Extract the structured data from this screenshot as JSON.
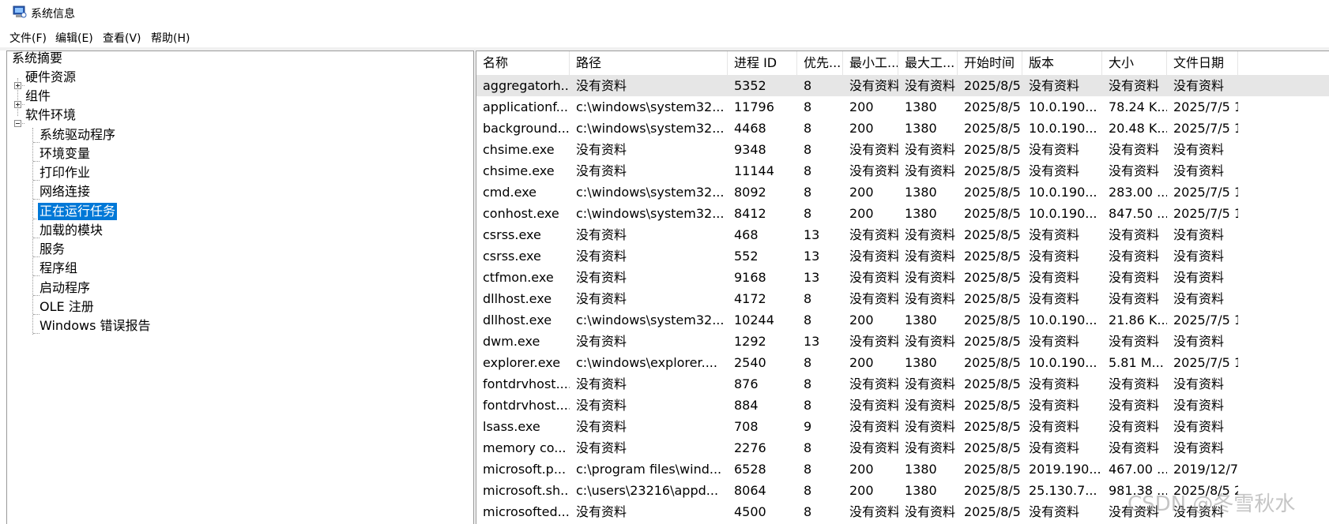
{
  "window": {
    "title": "系统信息"
  },
  "menu": [
    "文件(F)",
    "编辑(E)",
    "查看(V)",
    "帮助(H)"
  ],
  "tree": {
    "root": "系统摘要",
    "hardware": "硬件资源",
    "components": "组件",
    "software": "软件环境",
    "children": [
      "系统驱动程序",
      "环境变量",
      "打印作业",
      "网络连接",
      "正在运行任务",
      "加载的模块",
      "服务",
      "程序组",
      "启动程序",
      "OLE 注册",
      "Windows 错误报告"
    ],
    "selected_index": 4
  },
  "table": {
    "columns": [
      "名称",
      "路径",
      "进程 ID",
      "优先...",
      "最小工...",
      "最大工...",
      "开始时间",
      "版本",
      "大小",
      "文件日期"
    ],
    "rows": [
      [
        "aggregatorh...",
        "没有资料",
        "5352",
        "8",
        "没有资料",
        "没有资料",
        "2025/8/5 2...",
        "没有资料",
        "没有资料",
        "没有资料"
      ],
      [
        "applicationf...",
        "c:\\windows\\system32...",
        "11796",
        "8",
        "200",
        "1380",
        "2025/8/5 2...",
        "10.0.190...",
        "78.24 K...",
        "2025/7/5 1..."
      ],
      [
        "background...",
        "c:\\windows\\system32...",
        "4468",
        "8",
        "200",
        "1380",
        "2025/8/5 2...",
        "10.0.190...",
        "20.48 K...",
        "2025/7/5 1..."
      ],
      [
        "chsime.exe",
        "没有资料",
        "9348",
        "8",
        "没有资料",
        "没有资料",
        "2025/8/5 2...",
        "没有资料",
        "没有资料",
        "没有资料"
      ],
      [
        "chsime.exe",
        "没有资料",
        "11144",
        "8",
        "没有资料",
        "没有资料",
        "2025/8/5 2...",
        "没有资料",
        "没有资料",
        "没有资料"
      ],
      [
        "cmd.exe",
        "c:\\windows\\system32...",
        "8092",
        "8",
        "200",
        "1380",
        "2025/8/5 2...",
        "10.0.190...",
        "283.00 ...",
        "2025/7/5 1..."
      ],
      [
        "conhost.exe",
        "c:\\windows\\system32...",
        "8412",
        "8",
        "200",
        "1380",
        "2025/8/5 2...",
        "10.0.190...",
        "847.50 ...",
        "2025/7/5 1..."
      ],
      [
        "csrss.exe",
        "没有资料",
        "468",
        "13",
        "没有资料",
        "没有资料",
        "2025/8/5 2...",
        "没有资料",
        "没有资料",
        "没有资料"
      ],
      [
        "csrss.exe",
        "没有资料",
        "552",
        "13",
        "没有资料",
        "没有资料",
        "2025/8/5 2...",
        "没有资料",
        "没有资料",
        "没有资料"
      ],
      [
        "ctfmon.exe",
        "没有资料",
        "9168",
        "13",
        "没有资料",
        "没有资料",
        "2025/8/5 2...",
        "没有资料",
        "没有资料",
        "没有资料"
      ],
      [
        "dllhost.exe",
        "没有资料",
        "4172",
        "8",
        "没有资料",
        "没有资料",
        "2025/8/5 2...",
        "没有资料",
        "没有资料",
        "没有资料"
      ],
      [
        "dllhost.exe",
        "c:\\windows\\system32...",
        "10244",
        "8",
        "200",
        "1380",
        "2025/8/5 2...",
        "10.0.190...",
        "21.86 K...",
        "2025/7/5 1..."
      ],
      [
        "dwm.exe",
        "没有资料",
        "1292",
        "13",
        "没有资料",
        "没有资料",
        "2025/8/5 2...",
        "没有资料",
        "没有资料",
        "没有资料"
      ],
      [
        "explorer.exe",
        "c:\\windows\\explorer....",
        "2540",
        "8",
        "200",
        "1380",
        "2025/8/5 2...",
        "10.0.190...",
        "5.81 M...",
        "2025/7/5 1..."
      ],
      [
        "fontdrvhost....",
        "没有资料",
        "876",
        "8",
        "没有资料",
        "没有资料",
        "2025/8/5 2...",
        "没有资料",
        "没有资料",
        "没有资料"
      ],
      [
        "fontdrvhost....",
        "没有资料",
        "884",
        "8",
        "没有资料",
        "没有资料",
        "2025/8/5 2...",
        "没有资料",
        "没有资料",
        "没有资料"
      ],
      [
        "lsass.exe",
        "没有资料",
        "708",
        "9",
        "没有资料",
        "没有资料",
        "2025/8/5 2...",
        "没有资料",
        "没有资料",
        "没有资料"
      ],
      [
        "memory co...",
        "没有资料",
        "2276",
        "8",
        "没有资料",
        "没有资料",
        "2025/8/5 2...",
        "没有资料",
        "没有资料",
        "没有资料"
      ],
      [
        "microsoft.p...",
        "c:\\program files\\wind...",
        "6528",
        "8",
        "200",
        "1380",
        "2025/8/5 2...",
        "2019.190...",
        "467.00 ...",
        "2019/12/7 ..."
      ],
      [
        "microsoft.sh...",
        "c:\\users\\23216\\appd...",
        "8064",
        "8",
        "200",
        "1380",
        "2025/8/5 2...",
        "25.130.7...",
        "981.38 ...",
        "2025/8/5 2..."
      ],
      [
        "microsofted...",
        "没有资料",
        "4500",
        "8",
        "没有资料",
        "没有资料",
        "2025/8/5 2...",
        "没有资料",
        "没有资料",
        "没有资料"
      ]
    ]
  },
  "watermark": "CSDN @冬雪秋水"
}
